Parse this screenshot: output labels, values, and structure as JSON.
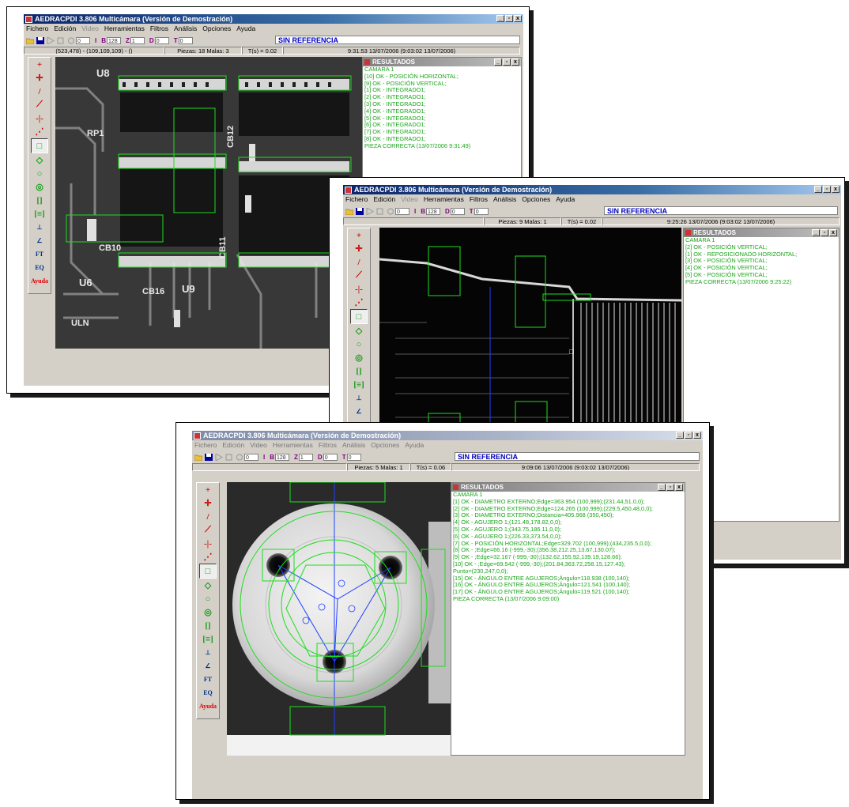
{
  "windows": [
    {
      "title": "AEDRACPDI 3.806 Multicámara  (Versión de Demostración)",
      "menu": [
        "Fichero",
        "Edición",
        "Video",
        "Herramientas",
        "Filtros",
        "Análisis",
        "Opciones",
        "Ayuda"
      ],
      "reference": "SIN REFERENCIA",
      "spin_values": [
        "0",
        "128",
        "1",
        "0",
        "0",
        "0",
        "0"
      ],
      "status": {
        "coords": "(523,478) - (109,109,109) - ()",
        "pieces": "Piezas: 18  Malas: 3",
        "time": "T(s) = 0.02",
        "datetime": "9:31:53 13/07/2006  (9:03:02 13/07/2006)"
      },
      "results_title": "RESULTADOS",
      "results": [
        "CAMARA 1",
        "[10] OK - POSICIÓN HORIZONTAL;",
        "[9] OK - POSICIÓN VERTICAL;",
        "[1] OK - INTEGRADO1;",
        "[2] OK - INTEGRADO1;",
        "[3] OK - INTEGRADO1;",
        "[4] OK - INTEGRADO1;",
        "[5] OK - INTEGRADO1;",
        "[6] OK - INTEGRADO1;",
        "[7] OK - INTEGRADO1;",
        "[8] OK - INTEGRADO1;",
        "PIEZA CORRECTA (13/07/2006 9:31:49)"
      ],
      "image_labels": [
        "U8",
        "RP1",
        "CB12",
        "CB10",
        "CB11",
        "U6",
        "CB16",
        "U9",
        "ULN"
      ]
    },
    {
      "title": "AEDRACPDI 3.806 Multicámara  (Versión de Demostración)",
      "menu": [
        "Fichero",
        "Edición",
        "Video",
        "Herramientas",
        "Filtros",
        "Análisis",
        "Opciones",
        "Ayuda"
      ],
      "reference": "SIN REFERENCIA",
      "spin_values": [
        "0",
        "128",
        "1",
        "0",
        "0",
        "0",
        "0"
      ],
      "status": {
        "coords": "",
        "pieces": "Piezas: 9  Malas: 1",
        "time": "T(s) = 0.02",
        "datetime": "9:25:26 13/07/2006  (9:03:02 13/07/2006)"
      },
      "results_title": "RESULTADOS",
      "results": [
        "CAMARA 1",
        "[2] OK - POSICIÓN VERTICAL;",
        "[1] OK - REPOSICIONADO HORIZONTAL;",
        "[3] OK - POSICIÓN VERTICAL;",
        "[4] OK - POSICIÓN VERTICAL;",
        "[5] OK - POSICIÓN VERTICAL;",
        "PIEZA CORRECTA (13/07/2006 9:25:22)"
      ]
    },
    {
      "title": "AEDRACPDI 3.806 Multicámara  (Versión de Demostración)",
      "menu": [
        "Fichero",
        "Edición",
        "Video",
        "Herramientas",
        "Filtros",
        "Análisis",
        "Opciones",
        "Ayuda"
      ],
      "reference": "SIN REFERENCIA",
      "spin_values": [
        "0",
        "128",
        "1",
        "0",
        "0",
        "0",
        "0"
      ],
      "status": {
        "coords": "",
        "pieces": "Piezas: 5  Malas: 1",
        "time": "T(s) = 0.06",
        "datetime": "9:09:06 13/07/2006  (9:03:02 13/07/2006)"
      },
      "results_title": "RESULTADOS",
      "results": [
        "CAMARA 1",
        "[1] OK - DIAMETRO EXTERNO;Edge=363.954 (100,999);(231.44,51.0,0);",
        "[2] OK - DIAMETRO EXTERNO;Edge=124.265 (100,999);(229.5,450.48,0,0);",
        "[3] OK - DIAMETRO EXTERNO;Distancia=405.968 (350,450);",
        "[4] OK - AGUJERO 1;(121.48,178.82,0,0);",
        "[5] OK - AGUJERO 1;(343.75,186.11,0,0);",
        "[6] OK - AGUJERO 1;(226.33,373.54,0,0);",
        "[7] OK - POSICIÓN HORIZONTAL;Edge=329.702 (100,999);(434,235.5,0,0);",
        "[8] OK - ;Edge=66.16 (-999,-30);(356.38,212.25,13.67,130.07);",
        "[9] OK - ;Edge=32.167 (-999,-30);(132.62,155.92,139.19,128.66);",
        "[10] OK - ;Edge=69.542 (-999,-30);(201.84,363.72,258.15,127.43);",
        "Punto=(230,247,0,0);",
        "[15] OK - ÁNGULO ENTRE AGUJEROS;Ángulo=118.938 (100,140);",
        "[16] OK - ÁNGULO ENTRE AGUJEROS;Ángulo=121.541 (100,140);",
        "[17] OK - ÁNGULO ENTRE AGUJEROS;Ángulo=119.521 (100,140);",
        "PIEZA CORRECTA (13/07/2006 9:09:00)"
      ]
    }
  ],
  "tools": [
    "+",
    "✛",
    "/",
    "⟋",
    "-|-",
    "⋰",
    "□",
    "◇",
    "○",
    "◎",
    "[]",
    "[≡]",
    "⊥",
    "∠",
    "FT",
    "EQ",
    "Ayuda"
  ],
  "toolbar_labels": [
    "I",
    "B",
    "Z",
    "D",
    "T"
  ],
  "window_buttons": [
    "_",
    "▫",
    "x"
  ],
  "colors": {
    "accent_green": "#1aa51a",
    "title_blue": "#0a246a",
    "ref_text": "#0000c0"
  }
}
